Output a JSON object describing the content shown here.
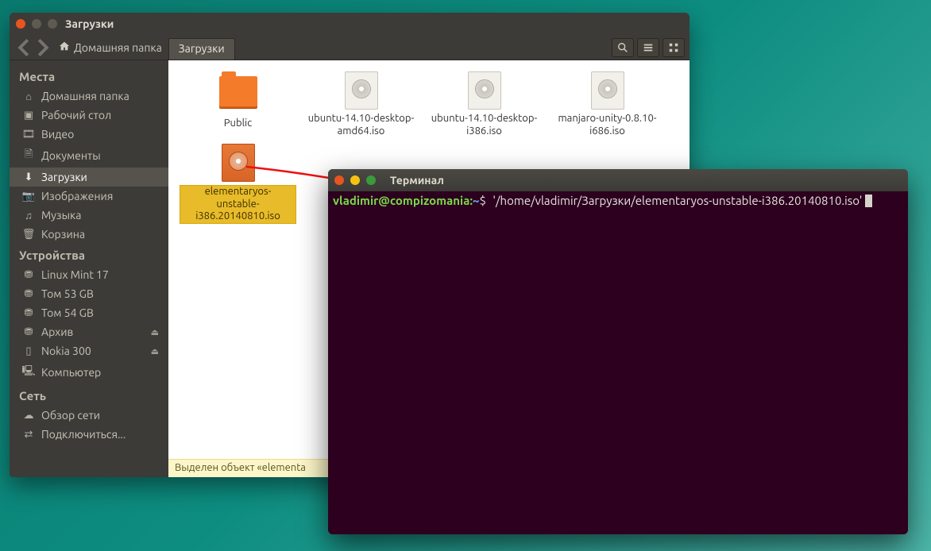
{
  "filemanager": {
    "window_title": "Загрузки",
    "breadcrumb_home": "Домашняя папка",
    "breadcrumb_current": "Загрузки",
    "sidebar": {
      "places_header": "Места",
      "devices_header": "Устройства",
      "network_header": "Сеть",
      "places": [
        {
          "icon": "home",
          "label": "Домашняя папка"
        },
        {
          "icon": "desktop",
          "label": "Рабочий стол"
        },
        {
          "icon": "video",
          "label": "Видео"
        },
        {
          "icon": "documents",
          "label": "Документы"
        },
        {
          "icon": "downloads",
          "label": "Загрузки",
          "active": true
        },
        {
          "icon": "pictures",
          "label": "Изображения"
        },
        {
          "icon": "music",
          "label": "Музыка"
        },
        {
          "icon": "trash",
          "label": "Корзина"
        }
      ],
      "devices": [
        {
          "icon": "drive",
          "label": "Linux Mint 17"
        },
        {
          "icon": "drive",
          "label": "Том 53 GB"
        },
        {
          "icon": "drive",
          "label": "Том 54 GB"
        },
        {
          "icon": "drive",
          "label": "Архив",
          "eject": true
        },
        {
          "icon": "phone",
          "label": "Nokia 300",
          "eject": true
        },
        {
          "icon": "computer",
          "label": "Компьютер"
        }
      ],
      "network": [
        {
          "icon": "network",
          "label": "Обзор сети"
        },
        {
          "icon": "connect",
          "label": "Подключиться..."
        }
      ]
    },
    "files": [
      {
        "type": "folder",
        "label": "Public"
      },
      {
        "type": "iso",
        "label": "ubuntu-14.10-desktop-amd64.iso"
      },
      {
        "type": "iso",
        "label": "ubuntu-14.10-desktop-i386.iso"
      },
      {
        "type": "iso",
        "label": "manjaro-unity-0.8.10-i686.iso"
      },
      {
        "type": "iso-orange",
        "label": "elementaryos-unstable-i386.20140810.iso",
        "selected": true
      }
    ],
    "statusbar": "Выделен объект «elementa"
  },
  "terminal": {
    "window_title": "Терминал",
    "prompt_user": "vladimir@compizomania",
    "prompt_path": "~",
    "prompt_symbol": "$",
    "command": "'/home/vladimir/Загрузки/elementaryos-unstable-i386.20140810.iso' "
  }
}
